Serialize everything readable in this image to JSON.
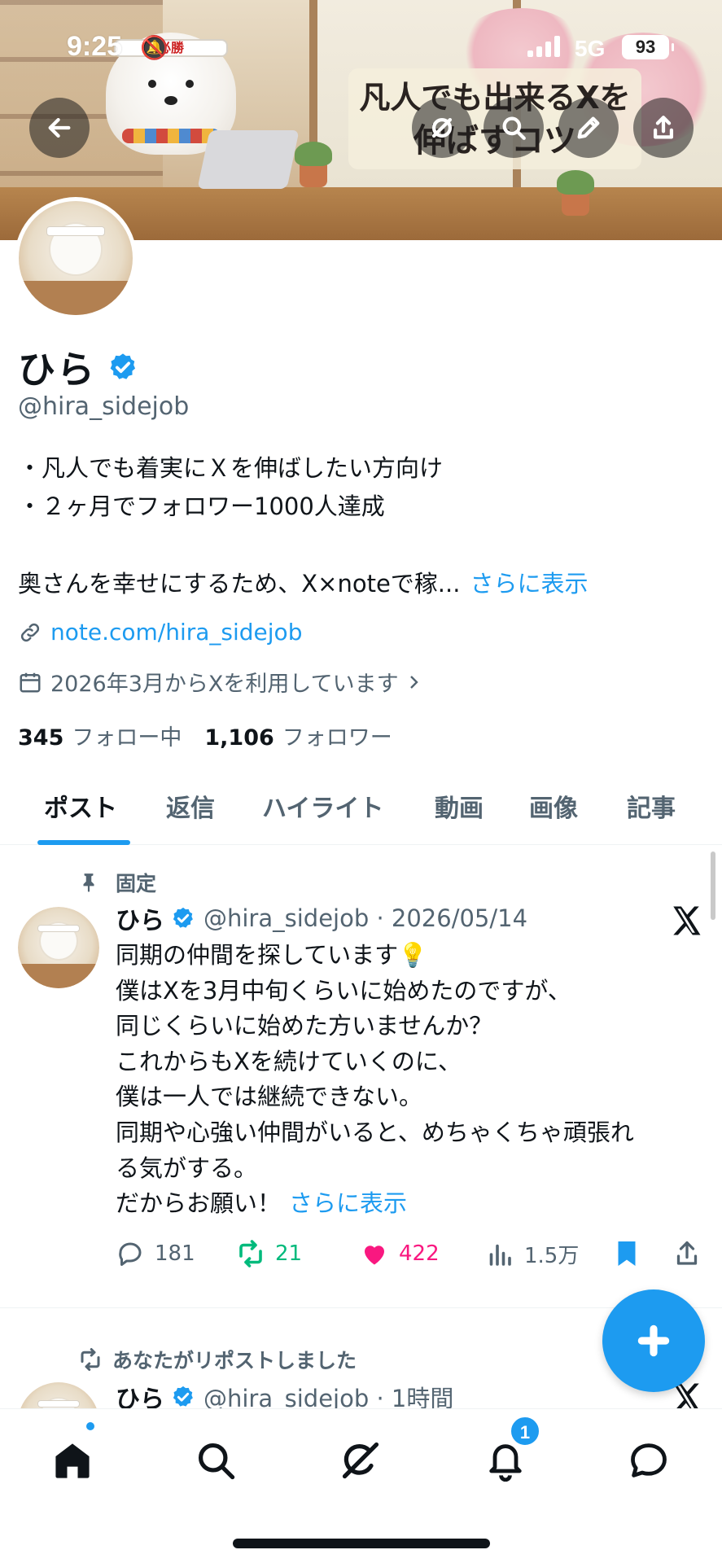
{
  "status_bar": {
    "time": "9:25",
    "network": "5G",
    "battery": "93"
  },
  "banner": {
    "title_line1": "凡人でも出来るXを",
    "title_line2": "伸ばすコツ",
    "headband_text": "必勝"
  },
  "header_buttons": [
    "back-icon",
    "grok-icon",
    "search-icon",
    "edit-icon",
    "share-icon"
  ],
  "profile": {
    "name": "ひら",
    "handle": "@hira_sidejob",
    "bio_lines": [
      "・凡人でも着実にＸを伸ばしたい方向け",
      "・２ヶ月でフォロワー1000人達成"
    ],
    "bio_truncated": "奥さんを幸せにするため、X×noteで稼...",
    "show_more": "さらに表示",
    "link": "note.com/hira_sidejob",
    "joined": "2026年3月からXを利用しています",
    "following_count": "345",
    "following_label": "フォロー中",
    "followers_count": "1,106",
    "followers_label": "フォロワー"
  },
  "tabs": [
    "ポスト",
    "返信",
    "ハイライト",
    "動画",
    "画像",
    "記事"
  ],
  "active_tab": "ポスト",
  "pinned_post": {
    "pinned_label": "固定",
    "name": "ひら",
    "handle_date": "@hira_sidejob · 2026/05/14",
    "lines": [
      "同期の仲間を探しています💡",
      "僕はXを3月中旬くらいに始めたのですが、",
      "同じくらいに始めた方いませんか？",
      "これからもXを続けていくのに、",
      "僕は一人では継続できない。",
      "同期や心強い仲間がいると、めちゃくちゃ頑張れ",
      "る気がする。"
    ],
    "last_line": "だからお願い！",
    "show_more": "さらに表示",
    "replies": "181",
    "reposts": "21",
    "likes": "422",
    "views": "1.5万"
  },
  "second_post": {
    "repost_label": "あなたがリポストしました",
    "name": "ひら",
    "handle_time": "@hira_sidejob · 1時間"
  },
  "bottom_nav": {
    "items": [
      "home-icon",
      "search-icon",
      "grok-icon",
      "notifications-icon",
      "messages-icon"
    ],
    "notification_count": "1"
  },
  "colors": {
    "accent": "#1d9bf0",
    "like": "#f91880",
    "repost": "#00ba7c",
    "text": "#0f1419",
    "secondary": "#536471"
  }
}
